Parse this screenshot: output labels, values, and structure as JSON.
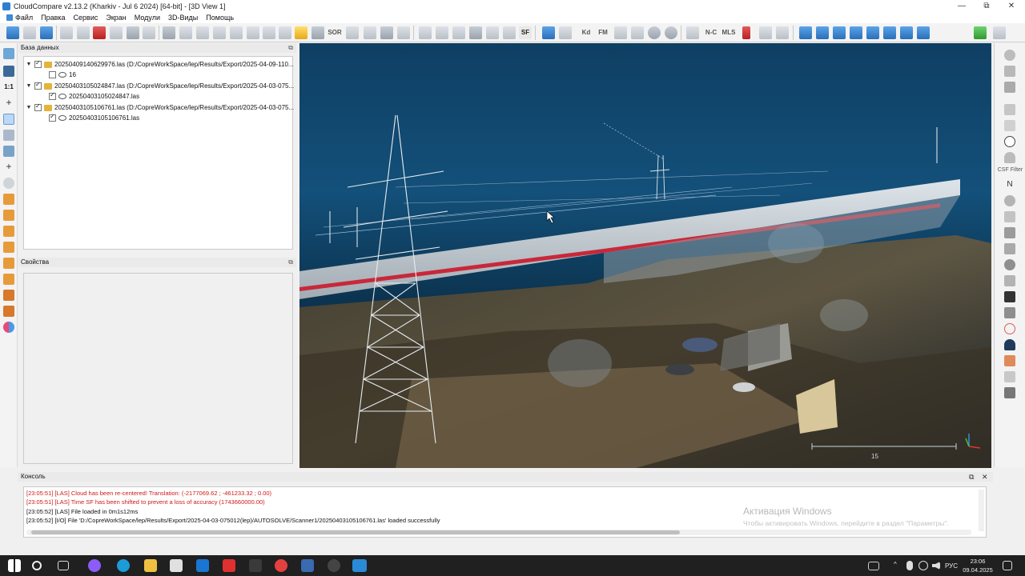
{
  "window": {
    "title": "CloudCompare v2.13.2 (Kharkiv - Jul  6 2024) [64-bit] - [3D View 1]",
    "controls": [
      "—",
      "⧉",
      "✕"
    ]
  },
  "menu": [
    "Файл",
    "Правка",
    "Сервис",
    "Экран",
    "Модули",
    "3D-Виды",
    "Помощь"
  ],
  "toolbar": {
    "sor_label": "SOR",
    "sf_label": "SF",
    "kd_label": "Kd",
    "fm_label": "FM",
    "nc_label": "N-C",
    "mls_label": "MLS"
  },
  "left_toolbar": {
    "scale_label": "1:1"
  },
  "db_panel": {
    "title": "База данных",
    "items": [
      {
        "label": "20250409140629976.las (D:/CopreWorkSpace/lep/Results/Export/2025-04-09-110...",
        "checked": true,
        "child": {
          "label": "16",
          "checked": false
        }
      },
      {
        "label": "20250403105024847.las (D:/CopreWorkSpace/lep/Results/Export/2025-04-03-075...",
        "checked": true,
        "child": {
          "label": "20250403105024847.las",
          "checked": true
        }
      },
      {
        "label": "20250403105106761.las (D:/CopreWorkSpace/lep/Results/Export/2025-04-03-075...",
        "checked": true,
        "child": {
          "label": "20250403105106761.las",
          "checked": true
        }
      }
    ]
  },
  "props_panel": {
    "title": "Свойства"
  },
  "right_toolbar": {
    "csf_label": "CSF Filter"
  },
  "view3d": {
    "scale_value": "15"
  },
  "console": {
    "title": "Консоль",
    "lines": [
      {
        "text": "[23:05:51] [LAS] Cloud has been re-centered! Translation: (-2177069.62 ; -461233.32 ; 0.00)",
        "color": "red"
      },
      {
        "text": "[23:05:51] [LAS] Time SF has been shifted to prevent a loss of accuracy (1743660000.00)",
        "color": "red"
      },
      {
        "text": "[23:05:52] [LAS] File loaded in 0m1s12ms",
        "color": "black"
      },
      {
        "text": "[23:05:52] [I/O] File 'D:/CopreWorkSpace/lep/Results/Export/2025-04-03-075012(lep)/AUTOSOLVE/Scanner1/20250403105106761.las' loaded successfully",
        "color": "black"
      }
    ],
    "watermark_title": "Активация Windows",
    "watermark_sub": "Чтобы активировать Windows, перейдите в раздел \"Параметры\"."
  },
  "taskbar": {
    "lang": "РУС",
    "time": "23:06",
    "date": "09.04.2025"
  },
  "colors": {
    "view_bg": "#13507a",
    "accent": "#2d7fd1",
    "console_error": "#d01818"
  }
}
